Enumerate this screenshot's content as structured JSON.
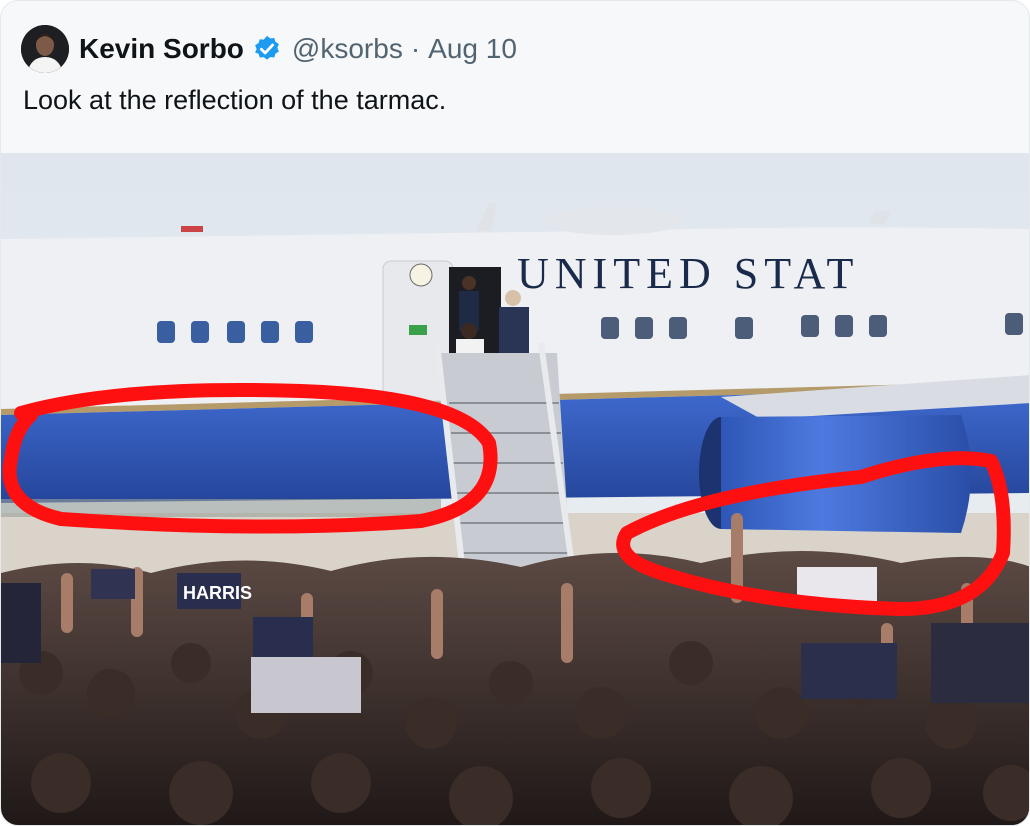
{
  "tweet": {
    "author": {
      "display_name": "Kevin Sorbo",
      "handle": "@ksorbs",
      "verified": true
    },
    "separator": "·",
    "timestamp": "Aug 10",
    "text": "Look at the reflection of the tarmac."
  },
  "media": {
    "aircraft_text": "UNITED STAT",
    "sign_text": "HARRIS",
    "colors": {
      "fuselage_white": "#eef0f3",
      "fuselage_blue": "#3c67c9",
      "annotation_red": "#ff1010",
      "sky": "#e4e9ee"
    }
  }
}
